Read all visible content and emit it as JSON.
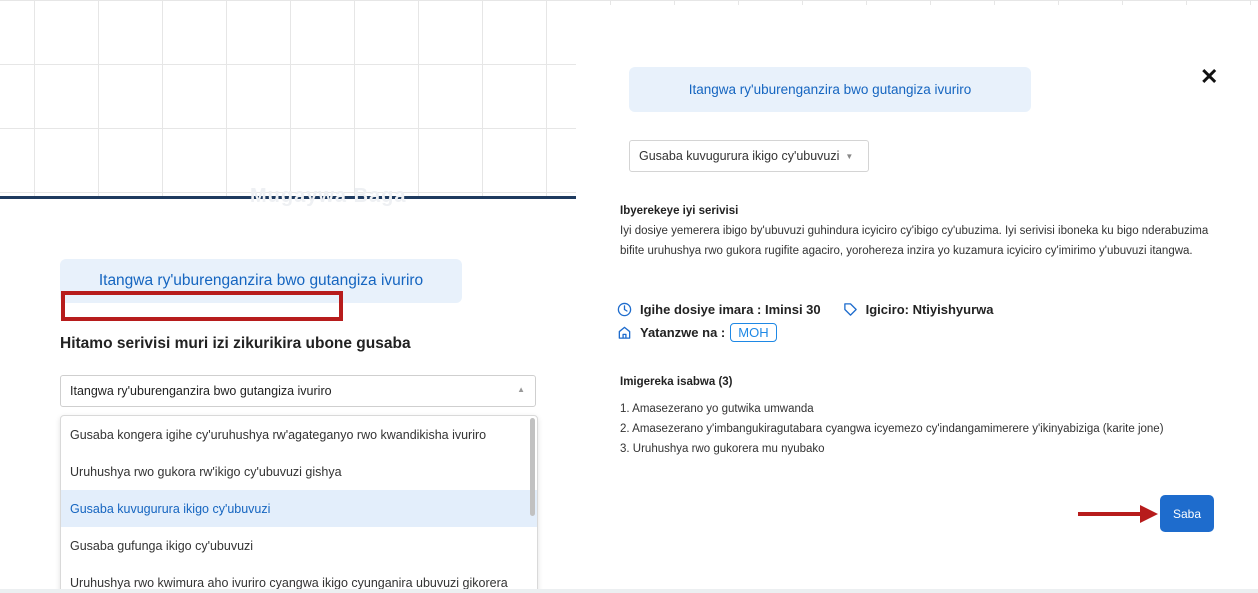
{
  "left": {
    "ghost_title": "Mugaywa Baga",
    "pill_title": "Itangwa ry'uburenganzira bwo gutangiza ivuriro",
    "heading": "Hitamo serivisi muri izi zikurikira ubone gusaba",
    "select_value": "Itangwa ry'uburenganzira bwo gutangiza ivuriro",
    "options": [
      "Gusaba kongera igihe cy'uruhushya rw'agateganyo rwo kwandikisha ivuriro",
      "Uruhushya rwo gukora rw'ikigo cy'ubuvuzi gishya",
      "Gusaba kuvugurura ikigo cy'ubuvuzi",
      "Gusaba gufunga ikigo cy'ubuvuzi",
      "Uruhushya rwo kwimura aho ivuriro cyangwa ikigo cyunganira ubuvuzi gikorera"
    ],
    "active_index": 2
  },
  "right": {
    "pill_title": "Itangwa ry'uburenganzira bwo gutangiza ivuriro",
    "close_label": "✕",
    "select_value": "Gusaba kuvugurura ikigo cy'ubuvuzi",
    "about_heading": "Ibyerekeye iyi serivisi",
    "about_text": "Iyi dosiye yemerera ibigo by'ubuvuzi guhindura icyiciro cy'ibigo cy'ubuzima. Iyi serivisi iboneka ku bigo nderabuzima bifite uruhushya rwo gukora rugifite agaciro, yorohereza inzira yo kuzamura icyiciro cy'imirimo y'ubuvuzi itangwa.",
    "duration": "Igihe dosiye imara : Iminsi 30",
    "price": "Igiciro: Ntiyishyurwa",
    "issued_by_label": "Yatanzwe na :",
    "issuer": "MOH",
    "requirements_heading": "Imigereka isabwa (3)",
    "requirements": [
      "1. Amasezerano yo gutwika umwanda",
      "2. Amasezerano y'imbangukiragutabara cyangwa icyemezo cy'indangamimerere y'ikinyabiziga (karite jone)",
      "3. Uruhushya rwo gukorera mu nyubako"
    ],
    "submit_label": "Saba"
  },
  "colors": {
    "accent_blue": "#1565c0",
    "pill_bg": "#e8f1fb",
    "button_blue": "#1e6ccd",
    "highlight_red": "#b71c1c",
    "active_row_bg": "#e3eefb"
  }
}
